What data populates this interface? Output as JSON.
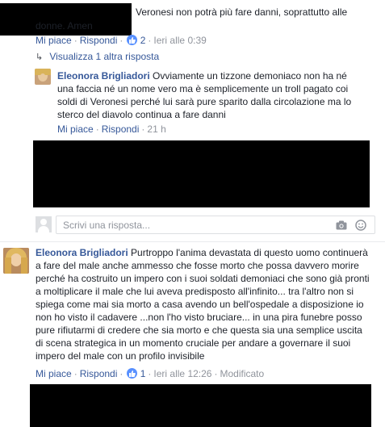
{
  "comment1": {
    "text_line1": "Veronesi non potrà più fare danni, soprattutto alle",
    "text_line2": "donne. Amen",
    "like": "Mi piace",
    "reply": "Rispondi",
    "likes_count": "2",
    "time": "Ieri alle 0:39"
  },
  "view_more": {
    "label": "Visualizza 1 altra risposta"
  },
  "reply1": {
    "author": "Eleonora Brigliadori",
    "text_line1": "Ovviamente un tizzone demoniaco non ha né",
    "text_line2": "una faccia né un nome vero ma è semplicemente un troll pagato coi",
    "text_line3": "soldi di Veronesi perché lui sarà pure sparito dalla circolazione ma lo",
    "text_line4": "sterco del diavolo continua a fare danni",
    "like": "Mi piace",
    "reply": "Rispondi",
    "time": "21 h"
  },
  "reply_input": {
    "placeholder": "Scrivi una risposta..."
  },
  "comment2": {
    "author": "Eleonora Brigliadori",
    "lines": [
      "Purtroppo l'anima devastata di questo uomo continuerà",
      "a fare del male anche ammesso che fosse morto che possa davvero morire",
      "perché ha costruito un impero con i suoi soldati demoniaci che sono già pronti",
      "a moltiplicare il male che lui aveva predisposto all'infinito... tra l'altro non si",
      "spiega come mai sia morto a casa avendo un bell'ospedale a disposizione io",
      "non ho visto il cadavere ...non l'ho visto bruciare... in una pira funebre posso",
      "pure rifiutarmi di credere che sia morto e che questa sia una semplice uscita",
      "di scena strategica in un momento cruciale per andare a governare il suoi",
      "impero del male con un profilo invisibile"
    ],
    "like": "Mi piace",
    "reply": "Rispondi",
    "likes_count": "1",
    "time": "Ieri alle 12:26",
    "edited": "Modificato"
  },
  "colors": {
    "link": "#365899",
    "meta": "#90949c",
    "text": "#1d2129",
    "like_badge": "#5890ff"
  }
}
